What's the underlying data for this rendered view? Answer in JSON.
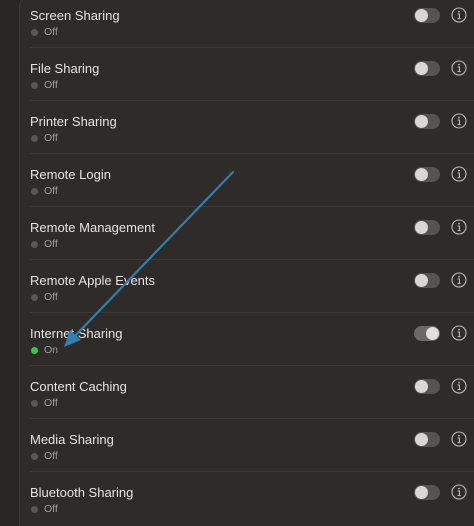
{
  "rows": [
    {
      "title": "Screen Sharing",
      "status": "Off",
      "on": false,
      "id": "screen-sharing"
    },
    {
      "title": "File Sharing",
      "status": "Off",
      "on": false,
      "id": "file-sharing"
    },
    {
      "title": "Printer Sharing",
      "status": "Off",
      "on": false,
      "id": "printer-sharing"
    },
    {
      "title": "Remote Login",
      "status": "Off",
      "on": false,
      "id": "remote-login"
    },
    {
      "title": "Remote Management",
      "status": "Off",
      "on": false,
      "id": "remote-management"
    },
    {
      "title": "Remote Apple Events",
      "status": "Off",
      "on": false,
      "id": "remote-apple-events"
    },
    {
      "title": "Internet Sharing",
      "status": "On",
      "on": true,
      "id": "internet-sharing"
    },
    {
      "title": "Content Caching",
      "status": "Off",
      "on": false,
      "id": "content-caching"
    },
    {
      "title": "Media Sharing",
      "status": "Off",
      "on": false,
      "id": "media-sharing"
    },
    {
      "title": "Bluetooth Sharing",
      "status": "Off",
      "on": false,
      "id": "bluetooth-sharing"
    }
  ],
  "colors": {
    "status_on": "#35c94a",
    "status_off": "#5b5653",
    "annotation_arrow": "#2f7fb0"
  },
  "icons": {
    "info": "info-circle-icon",
    "annotation": "annotation-arrow-icon"
  }
}
